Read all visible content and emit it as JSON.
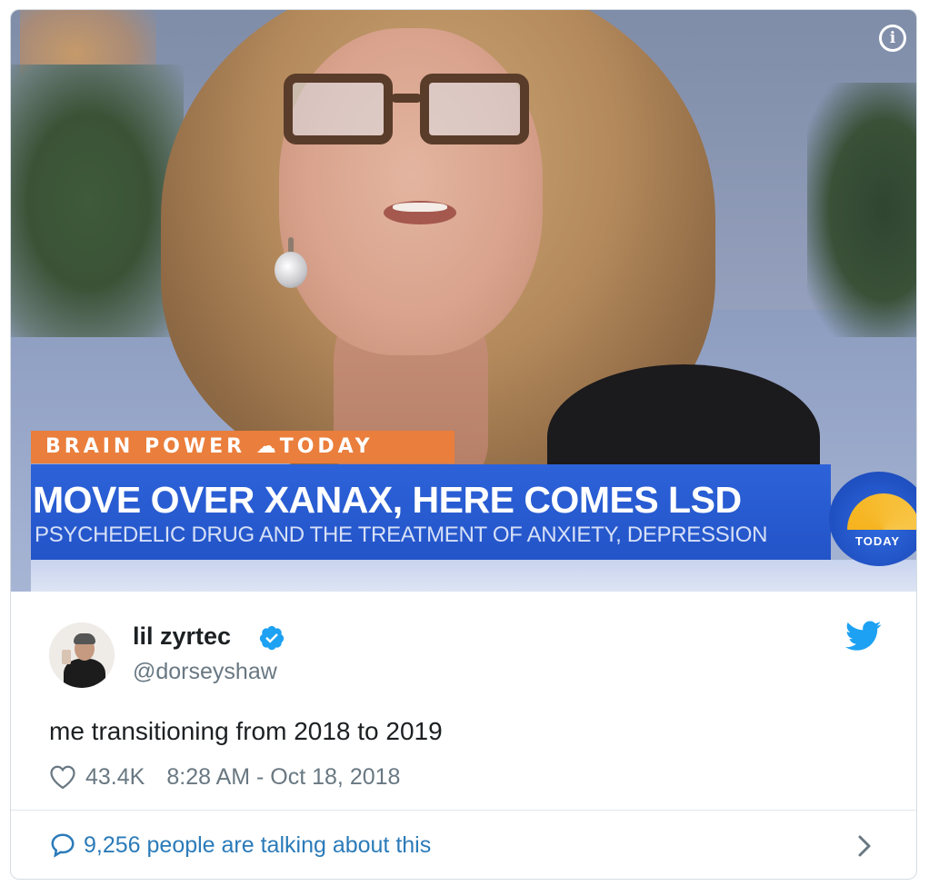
{
  "media": {
    "lower_third": {
      "tag": "BRAIN POWER ☁TODAY",
      "headline": "MOVE OVER XANAX, HERE COMES LSD",
      "subheadline": "PSYCHEDELIC DRUG AND THE TREATMENT OF ANXIETY, DEPRESSION",
      "logo_text": "TODAY"
    },
    "info_icon": "i"
  },
  "tweet": {
    "author_name": "lil zyrtec",
    "author_handle": "@dorseyshaw",
    "text": "me transitioning from 2018 to 2019",
    "like_count": "43.4K",
    "timestamp": "8:28 AM - Oct 18, 2018",
    "talking": "9,256 people are talking about this"
  },
  "icons": {
    "verified": "verified-badge-icon",
    "brand": "twitter-bird-icon",
    "like": "heart-icon",
    "reply": "speech-bubble-icon",
    "more": "chevron-right-icon",
    "info": "info-icon"
  },
  "colors": {
    "accent_blue": "#1da1f2",
    "link_blue": "#2b7bb9",
    "secondary_text": "#697882",
    "primary_text": "#1c2022",
    "lower_third_blue": "#2354c8",
    "lower_third_orange": "#ea7e3c"
  }
}
